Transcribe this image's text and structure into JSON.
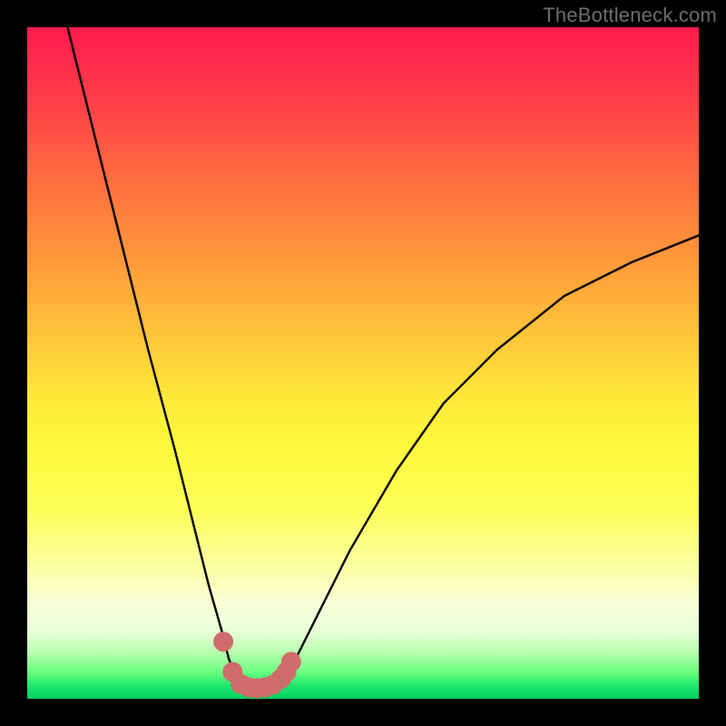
{
  "watermark": "TheBottleneck.com",
  "chart_data": {
    "type": "line",
    "title": "",
    "xlabel": "",
    "ylabel": "",
    "xlim": [
      0,
      100
    ],
    "ylim": [
      0,
      100
    ],
    "grid": false,
    "series": [
      {
        "name": "bottleneck-curve",
        "color": "#000000",
        "x": [
          6,
          10,
          14,
          18,
          22,
          25,
          27,
          29,
          30,
          31,
          32,
          33.5,
          35,
          37,
          38.5,
          40,
          43,
          48,
          55,
          62,
          70,
          80,
          90,
          100
        ],
        "values": [
          100,
          84,
          68,
          52,
          37,
          25,
          17,
          10,
          6,
          3.5,
          2.2,
          1.6,
          1.6,
          2.2,
          3.5,
          6,
          12,
          22,
          34,
          44,
          52,
          60,
          65,
          69
        ]
      }
    ],
    "markers": {
      "name": "highlight-dots",
      "color": "#cf6b6b",
      "radius_px": 11,
      "x": [
        29.2,
        30.6,
        31.8,
        33.0,
        34.2,
        35.4,
        36.6,
        37.8,
        38.6,
        39.3
      ],
      "values": [
        8.5,
        4.0,
        2.2,
        1.7,
        1.6,
        1.7,
        2.1,
        3.0,
        4.0,
        5.5
      ]
    }
  }
}
